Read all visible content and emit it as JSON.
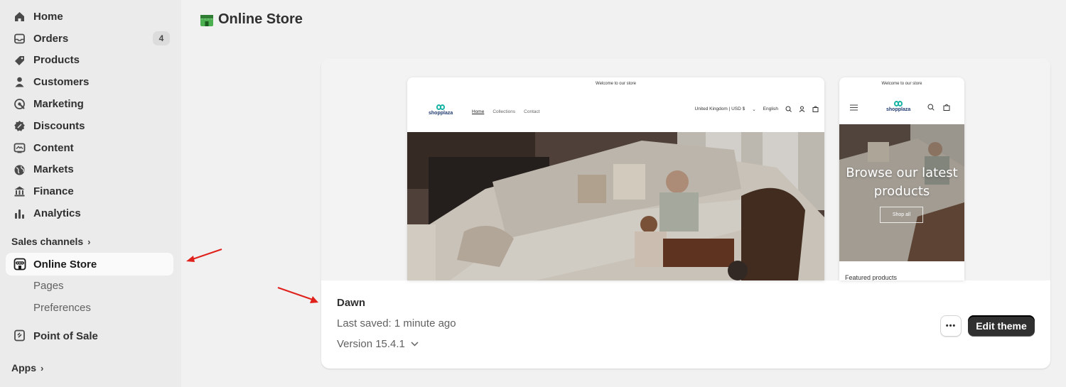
{
  "sidebar": {
    "items": [
      {
        "label": "Home",
        "icon": "home-icon"
      },
      {
        "label": "Orders",
        "icon": "inbox-icon",
        "badge": "4"
      },
      {
        "label": "Products",
        "icon": "tag-icon"
      },
      {
        "label": "Customers",
        "icon": "person-icon"
      },
      {
        "label": "Marketing",
        "icon": "target-icon"
      },
      {
        "label": "Discounts",
        "icon": "discount-icon"
      },
      {
        "label": "Content",
        "icon": "content-icon"
      },
      {
        "label": "Markets",
        "icon": "globe-icon"
      },
      {
        "label": "Finance",
        "icon": "bank-icon"
      },
      {
        "label": "Analytics",
        "icon": "bar-chart-icon"
      }
    ],
    "sales_channels_label": "Sales channels",
    "online_store_label": "Online Store",
    "sub_items": [
      "Pages",
      "Preferences"
    ],
    "pos_label": "Point of Sale",
    "apps_label": "Apps"
  },
  "header": {
    "title": "Online Store"
  },
  "theme_card": {
    "theme_name": "Dawn",
    "last_saved": "Last saved: 1 minute ago",
    "version": "Version 15.4.1",
    "more_label": "•••",
    "edit_label": "Edit theme",
    "desktop_preview": {
      "announcement": "Welcome to our store",
      "brand": "shopplaza",
      "nav": [
        "Home",
        "Collections",
        "Contact"
      ],
      "country": "United Kingdom | USD $",
      "language": "English"
    },
    "mobile_preview": {
      "announcement": "Welcome to our store",
      "brand": "shopplaza",
      "hero_line1": "Browse our latest",
      "hero_line2": "products",
      "shop_all": "Shop all",
      "featured": "Featured products"
    }
  },
  "colors": {
    "accent_arrow": "#e0211b",
    "edit_button": "#303030",
    "brand_teal": "#17b3a3"
  }
}
